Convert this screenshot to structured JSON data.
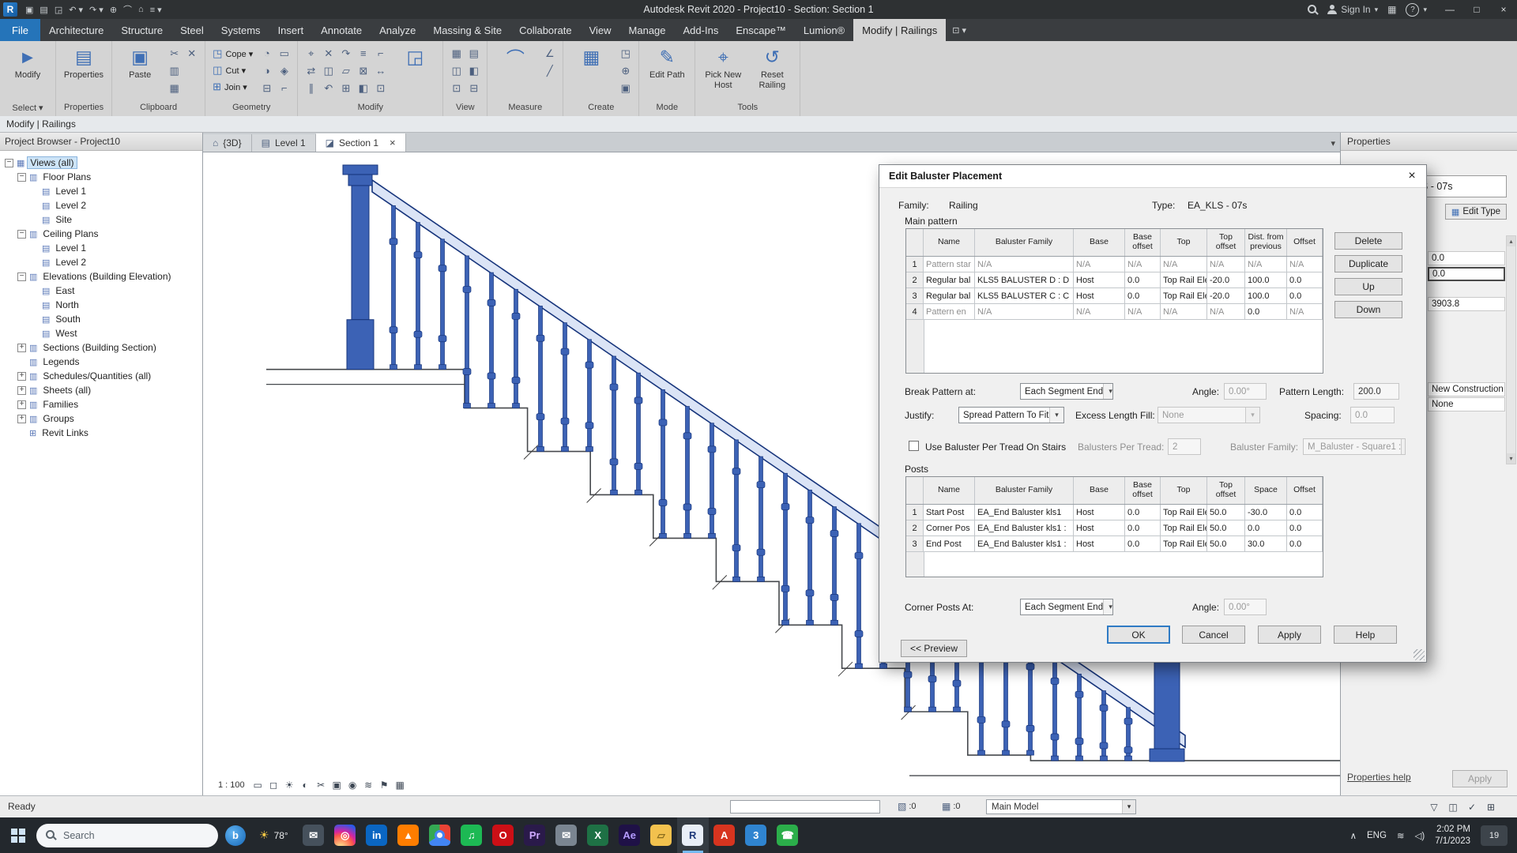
{
  "window": {
    "title": "Autodesk Revit 2020 - Project10 - Section: Section 1",
    "sign_in": "Sign In",
    "qat": [
      "save",
      "open",
      "sync",
      "undo",
      "redo",
      "print",
      "measure",
      "home",
      "menu"
    ],
    "controls": [
      "—",
      "□",
      "×"
    ]
  },
  "ribbon": {
    "tabs": [
      {
        "label": "File",
        "file": true
      },
      {
        "label": "Architecture"
      },
      {
        "label": "Structure"
      },
      {
        "label": "Steel"
      },
      {
        "label": "Systems"
      },
      {
        "label": "Insert"
      },
      {
        "label": "Annotate"
      },
      {
        "label": "Analyze"
      },
      {
        "label": "Massing & Site"
      },
      {
        "label": "Collaborate"
      },
      {
        "label": "View"
      },
      {
        "label": "Manage"
      },
      {
        "label": "Add-Ins"
      },
      {
        "label": "Enscape™"
      },
      {
        "label": "Lumion®"
      },
      {
        "label": "Modify | Railings",
        "active": true
      }
    ],
    "panels": [
      {
        "label": "Select ▾",
        "items": [
          {
            "big": "Modify",
            "glyph": "►",
            "name": "modify"
          }
        ]
      },
      {
        "label": "Properties",
        "items": [
          {
            "big": "Properties",
            "glyph": "▤",
            "name": "properties"
          }
        ]
      },
      {
        "label": "Clipboard",
        "items": [
          {
            "big": "Paste",
            "glyph": "▣",
            "name": "paste"
          },
          {
            "grid": [
              "✂",
              "▥",
              "▦",
              "✕"
            ]
          }
        ]
      },
      {
        "label": "Geometry",
        "items": [
          {
            "col": [
              {
                "glyph": "◳",
                "label": "Cope ▾"
              },
              {
                "glyph": "◫",
                "label": "Cut ▾"
              },
              {
                "glyph": "⊞",
                "label": "Join ▾"
              }
            ]
          },
          {
            "grid": [
              "◔",
              "◑",
              "⊟",
              "▭",
              "◈",
              "⌐"
            ]
          }
        ]
      },
      {
        "label": "Modify",
        "items": [
          {
            "grid": [
              "⌖",
              "⇄",
              "∥",
              "✕",
              "◫",
              "↶",
              "↷",
              "▱",
              "⊞",
              "≡",
              "⊠",
              "◧",
              "⌐",
              "↔",
              "⊡"
            ]
          },
          {
            "big": "",
            "glyph": "◲",
            "name": "trim"
          }
        ]
      },
      {
        "label": "View",
        "items": [
          {
            "grid": [
              "▦",
              "◫",
              "⊡",
              "▤",
              "◧",
              "⊟"
            ]
          }
        ]
      },
      {
        "label": "Measure",
        "items": [
          {
            "big": "",
            "glyph": "⌒",
            "name": "measure"
          },
          {
            "grid": [
              "∠",
              "╱"
            ]
          }
        ]
      },
      {
        "label": "Create",
        "items": [
          {
            "big": "",
            "glyph": "▦",
            "name": "create"
          },
          {
            "grid": [
              "◳",
              "⊕",
              "▣"
            ]
          }
        ]
      },
      {
        "label": "Mode",
        "items": [
          {
            "big": "Edit Path",
            "glyph": "✎",
            "name": "edit-path"
          }
        ]
      },
      {
        "label": "Tools",
        "items": [
          {
            "big": "Pick New Host",
            "glyph": "⌖",
            "name": "pick-new-host"
          },
          {
            "big": "Reset Railing",
            "glyph": "↺",
            "name": "reset-railing"
          }
        ]
      }
    ]
  },
  "info_bar": "Modify | Railings",
  "project_browser": {
    "title": "Project Browser - Project10",
    "items": [
      {
        "label": "Views (all)",
        "indent": 0,
        "expand": "minus",
        "icon": "views",
        "selected": true
      },
      {
        "label": "Floor Plans",
        "indent": 1,
        "expand": "minus",
        "icon": "category"
      },
      {
        "label": "Level 1",
        "indent": 2,
        "icon": "leaf"
      },
      {
        "label": "Level 2",
        "indent": 2,
        "icon": "leaf"
      },
      {
        "label": "Site",
        "indent": 2,
        "icon": "leaf"
      },
      {
        "label": "Ceiling Plans",
        "indent": 1,
        "expand": "minus",
        "icon": "category"
      },
      {
        "label": "Level 1",
        "indent": 2,
        "icon": "leaf"
      },
      {
        "label": "Level 2",
        "indent": 2,
        "icon": "leaf"
      },
      {
        "label": "Elevations (Building Elevation)",
        "indent": 1,
        "expand": "minus",
        "icon": "category"
      },
      {
        "label": "East",
        "indent": 2,
        "icon": "leaf"
      },
      {
        "label": "North",
        "indent": 2,
        "icon": "leaf"
      },
      {
        "label": "South",
        "indent": 2,
        "icon": "leaf"
      },
      {
        "label": "West",
        "indent": 2,
        "icon": "leaf"
      },
      {
        "label": "Sections (Building Section)",
        "indent": 1,
        "expand": "plus",
        "icon": "category"
      },
      {
        "label": "Legends",
        "indent": 1,
        "icon": "category"
      },
      {
        "label": "Schedules/Quantities (all)",
        "indent": 1,
        "expand": "plus",
        "icon": "category"
      },
      {
        "label": "Sheets (all)",
        "indent": 1,
        "expand": "plus",
        "icon": "category"
      },
      {
        "label": "Families",
        "indent": 1,
        "expand": "plus",
        "icon": "category"
      },
      {
        "label": "Groups",
        "indent": 1,
        "expand": "plus",
        "icon": "category"
      },
      {
        "label": "Revit Links",
        "indent": 1,
        "icon": "link"
      }
    ]
  },
  "view_tabs": [
    {
      "label": "{3D}",
      "icon": "3d"
    },
    {
      "label": "Level 1",
      "icon": "plan"
    },
    {
      "label": "Section 1",
      "icon": "section",
      "active": true
    }
  ],
  "view_controls": {
    "scale": "1 : 100",
    "icons": [
      "visual-style",
      "detail-level",
      "sun-path",
      "shadows",
      "crop-view",
      "crop-region",
      "temporary-hide",
      "reveal-hidden",
      "temporary-view",
      "analytical"
    ]
  },
  "dialog": {
    "title": "Edit Baluster Placement",
    "close": "×",
    "family_label": "Family:",
    "family_value": "Railing",
    "type_label": "Type:",
    "type_value": "EA_KLS - 07s",
    "main_pattern_label": "Main pattern",
    "main_columns": [
      "",
      "Name",
      "Baluster Family",
      "Base",
      "Base offset",
      "Top",
      "Top offset",
      "Dist. from previous",
      "Offset"
    ],
    "main_rows": [
      [
        "1",
        "Pattern star",
        "N/A",
        "N/A",
        "N/A",
        "N/A",
        "N/A",
        "N/A",
        "N/A"
      ],
      [
        "2",
        "Regular bal",
        "KLS5 BALUSTER D : D",
        "Host",
        "0.0",
        "Top Rail Ele",
        "-20.0",
        "100.0",
        "0.0"
      ],
      [
        "3",
        "Regular bal",
        "KLS5 BALUSTER C : C",
        "Host",
        "0.0",
        "Top Rail Ele",
        "-20.0",
        "100.0",
        "0.0"
      ],
      [
        "4",
        "Pattern en",
        "N/A",
        "N/A",
        "N/A",
        "N/A",
        "N/A",
        "0.0",
        "N/A"
      ]
    ],
    "side_buttons": [
      "Delete",
      "Duplicate",
      "Up",
      "Down"
    ],
    "break_label": "Break Pattern at:",
    "break_value": "Each Segment End",
    "angle_label": "Angle:",
    "angle_value": "0.00°",
    "pattern_length_label": "Pattern Length:",
    "pattern_length_value": "200.0",
    "justify_label": "Justify:",
    "justify_value": "Spread Pattern To Fit",
    "excess_label": "Excess Length Fill:",
    "excess_value": "None",
    "spacing_label": "Spacing:",
    "spacing_value": "0.0",
    "tread_checkbox_label": "Use Baluster Per Tread On Stairs",
    "balusters_per_tread_label": "Balusters Per Tread:",
    "balusters_per_tread_value": "2",
    "baluster_family_label": "Baluster Family:",
    "baluster_family_value": "M_Baluster - Square1 :",
    "posts_label": "Posts",
    "posts_columns": [
      "",
      "Name",
      "Baluster Family",
      "Base",
      "Base offset",
      "Top",
      "Top offset",
      "Space",
      "Offset"
    ],
    "posts_rows": [
      [
        "1",
        "Start Post",
        "EA_End Baluster kls1",
        "Host",
        "0.0",
        "Top Rail Ele",
        "50.0",
        "-30.0",
        "0.0"
      ],
      [
        "2",
        "Corner Pos",
        "EA_End Baluster kls1 :",
        "Host",
        "0.0",
        "Top Rail Ele",
        "50.0",
        "0.0",
        "0.0"
      ],
      [
        "3",
        "End Post",
        "EA_End Baluster kls1 :",
        "Host",
        "0.0",
        "Top Rail Ele",
        "50.0",
        "30.0",
        "0.0"
      ]
    ],
    "corner_label": "Corner Posts At:",
    "corner_value": "Each Segment End",
    "corner_angle_label": "Angle:",
    "corner_angle_value": "0.00°",
    "ok": "OK",
    "cancel": "Cancel",
    "apply": "Apply",
    "help": "Help",
    "preview": "<< Preview"
  },
  "properties_panel": {
    "title": "Properties",
    "type_value": "EA_KLS - 07s",
    "edit_type": "Edit Type",
    "values": [
      "0.0",
      "0.0",
      "3903.8",
      "New Construction",
      "None"
    ],
    "help_link": "Properties help",
    "apply": "Apply"
  },
  "status_bar": {
    "ready": "Ready",
    "counter1": ":0",
    "counter2": ":0",
    "main_model": "Main Model",
    "icons": [
      "filter",
      "select-box",
      "check",
      "grid"
    ]
  },
  "taskbar": {
    "search": "Search",
    "assistant": "b",
    "weather": "78°",
    "apps": [
      {
        "name": "mail",
        "glyph": "✉",
        "bg": "#46515c"
      },
      {
        "name": "instagram",
        "glyph": "◎",
        "cls": "insta"
      },
      {
        "name": "linkedin",
        "glyph": "in",
        "bg": "#0a66c2"
      },
      {
        "name": "vlc",
        "glyph": "▲",
        "bg": "#ff7d00"
      },
      {
        "name": "chrome",
        "glyph": "",
        "cls": "chrome"
      },
      {
        "name": "spotify",
        "glyph": "♫",
        "bg": "#1db954"
      },
      {
        "name": "opera",
        "glyph": "O",
        "bg": "#cc0f16"
      },
      {
        "name": "premiere",
        "glyph": "Pr",
        "bg": "#2a1a4a",
        "fg": "#cfa9ff"
      },
      {
        "name": "mail-2",
        "glyph": "✉",
        "bg": "#7a8591"
      },
      {
        "name": "excel",
        "glyph": "X",
        "bg": "#1e7145"
      },
      {
        "name": "after-effects",
        "glyph": "Ae",
        "bg": "#1f1147",
        "fg": "#b49bff"
      },
      {
        "name": "files",
        "glyph": "▱",
        "bg": "#f2c14e",
        "fg": "#8a6d1d"
      },
      {
        "name": "revit",
        "glyph": "R",
        "bg": "#e8eef7",
        "fg": "#1f3a7a",
        "active": true
      },
      {
        "name": "autodesk",
        "glyph": "A",
        "bg": "#d7341f"
      },
      {
        "name": "3ds-max",
        "glyph": "3",
        "bg": "#2f84d0"
      },
      {
        "name": "phone",
        "glyph": "☎",
        "bg": "#2bae4a"
      }
    ],
    "tray": {
      "icons": [
        "hidden-icons",
        "network",
        "volume"
      ],
      "lang": "ENG",
      "time": "2:02 PM",
      "date": "7/1/2023",
      "badge": "19"
    }
  }
}
